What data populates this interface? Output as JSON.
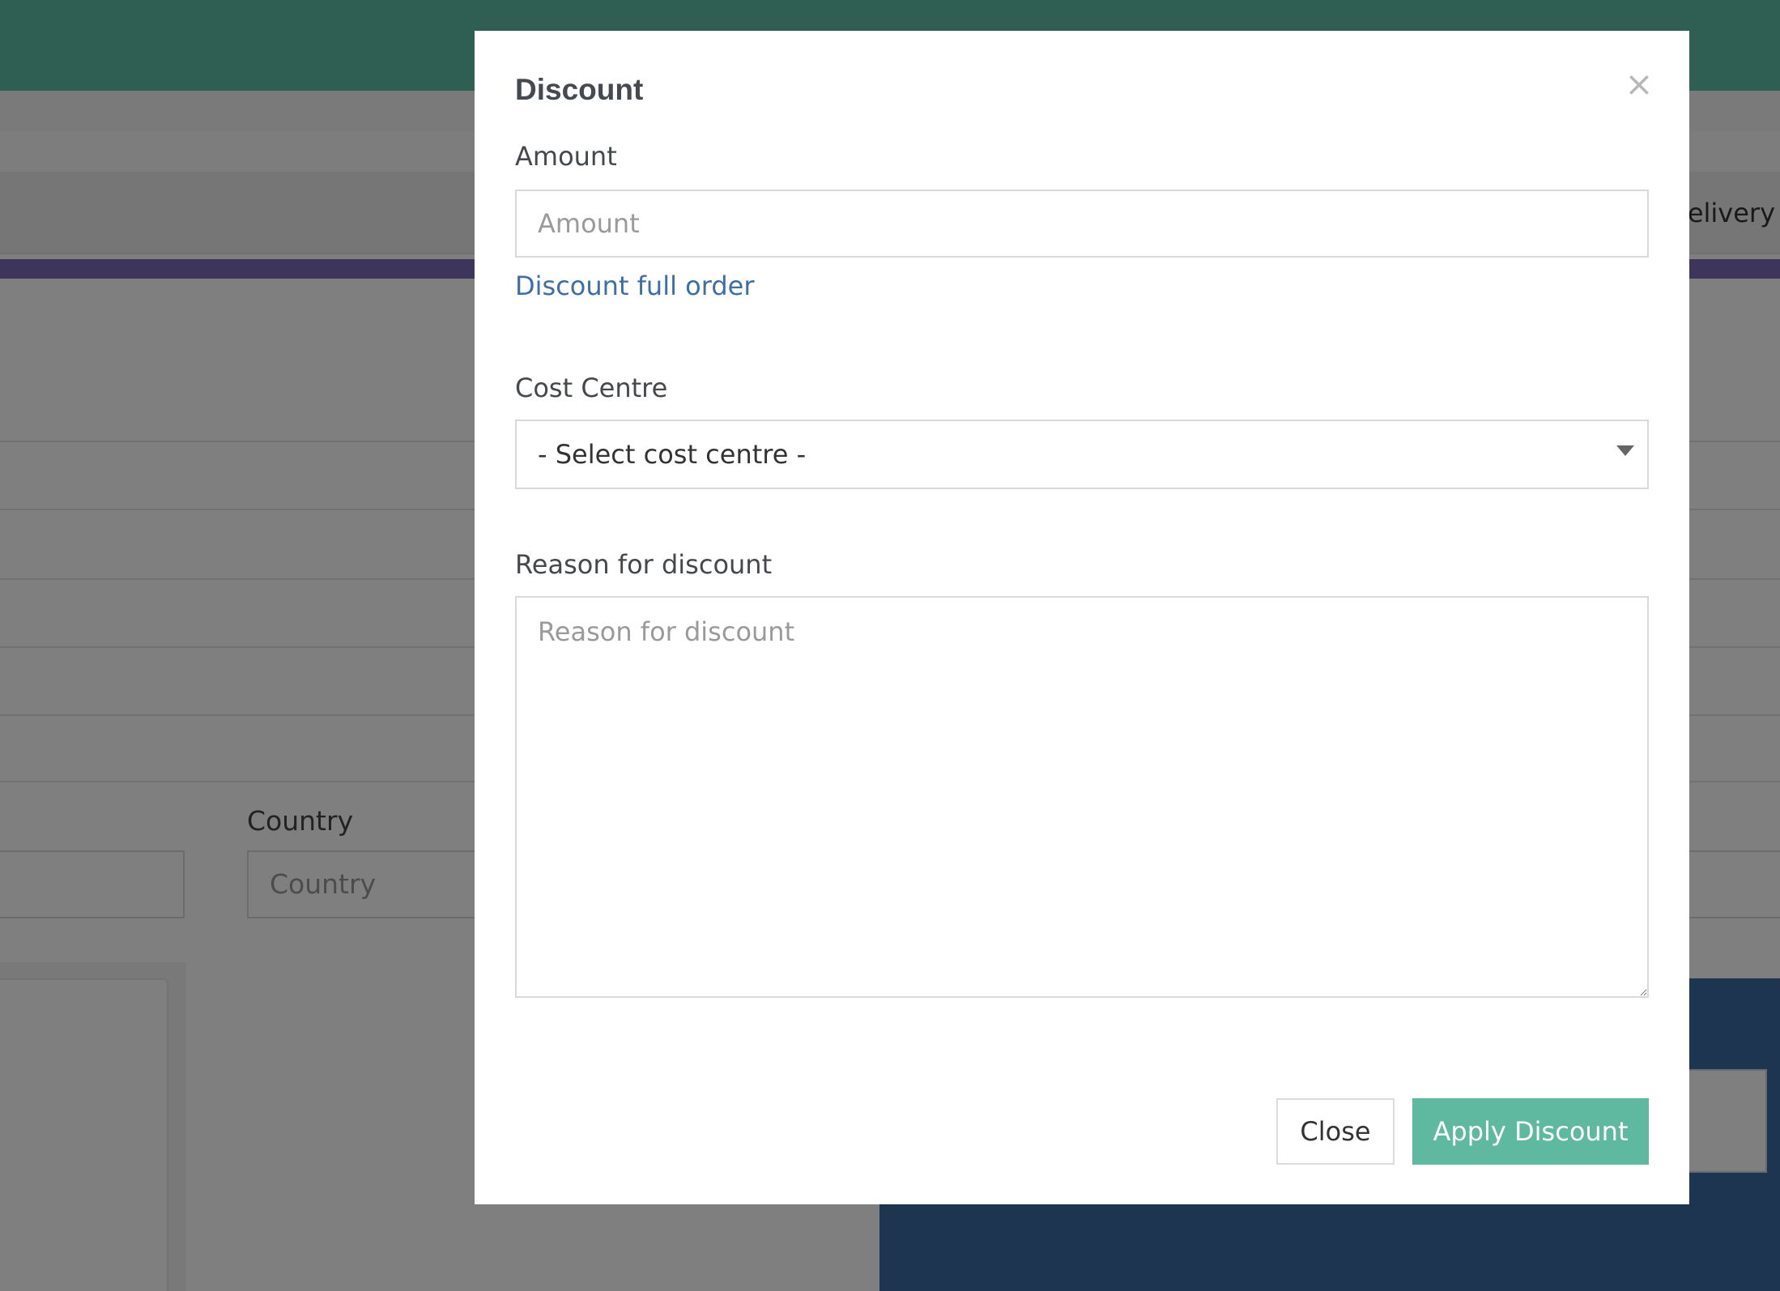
{
  "background": {
    "nav_partial_text": "Delivery",
    "country_label": "Country",
    "country_placeholder": "Country"
  },
  "modal": {
    "title": "Discount",
    "close_icon": "close-icon",
    "amount": {
      "label": "Amount",
      "placeholder": "Amount",
      "value": ""
    },
    "discount_full_order_link": "Discount full order",
    "cost_centre": {
      "label": "Cost Centre",
      "selected": "- Select cost centre -"
    },
    "reason": {
      "label": "Reason for discount",
      "placeholder": "Reason for discount",
      "value": ""
    },
    "buttons": {
      "close": "Close",
      "apply": "Apply Discount"
    }
  },
  "colors": {
    "brand_teal": "#5eb9a0",
    "link_blue": "#3e6ea8",
    "overlay": "rgba(0,0,0,0.5)"
  }
}
